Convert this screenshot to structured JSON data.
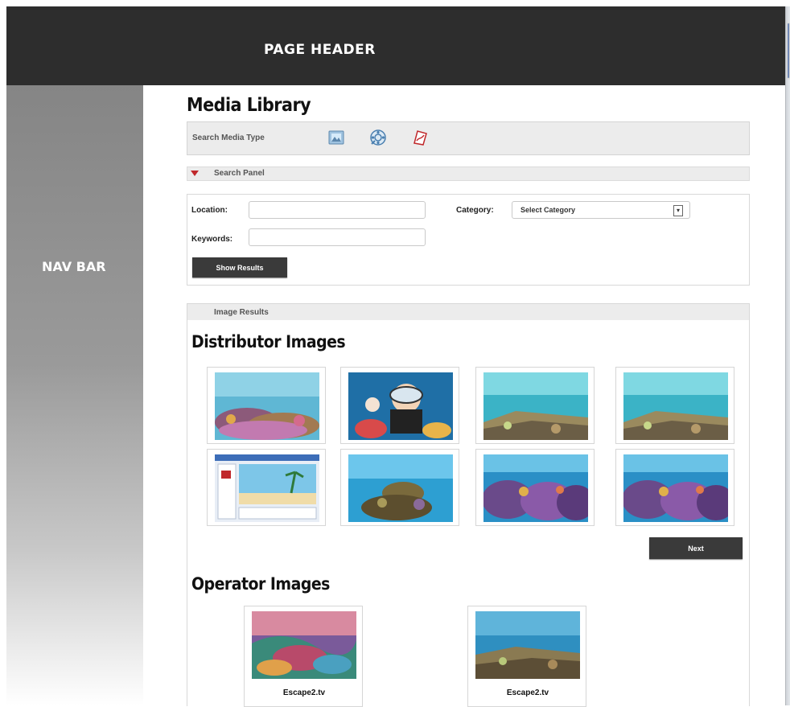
{
  "header": {
    "title": "PAGE HEADER"
  },
  "navbar": {
    "title": "NAV BAR"
  },
  "main": {
    "title": "Media Library",
    "media_type_bar": {
      "label": "Search Media Type",
      "icons": [
        "image-type-icon",
        "video-type-icon",
        "document-type-icon"
      ]
    },
    "search_panel": {
      "label": "Search Panel",
      "location_label": "Location:",
      "location_value": "",
      "keywords_label": "Keywords:",
      "keywords_value": "",
      "category_label": "Category:",
      "category_selected": "Select Category",
      "show_results_label": "Show Results"
    },
    "results": {
      "header_label": "Image Results",
      "distributor_title": "Distributor Images",
      "distributor_images": [
        "coral-reef-photo",
        "scuba-diver-photo",
        "reef-shallows-photo",
        "reef-shallows-photo",
        "website-screenshot",
        "coral-head-photo",
        "purple-coral-photo",
        "purple-coral-photo"
      ],
      "next_label": "Next",
      "operator_title": "Operator Images",
      "operator_images": [
        {
          "caption": "Escape2.tv",
          "image": "coral-painting"
        },
        {
          "caption": "Escape2.tv",
          "image": "reef-shallows-photo"
        }
      ]
    }
  },
  "colors": {
    "header_bg": "#2d2d2d",
    "button_bg": "#3a3a3a",
    "panel_bg": "#ececec",
    "accent_red": "#c0282b"
  }
}
